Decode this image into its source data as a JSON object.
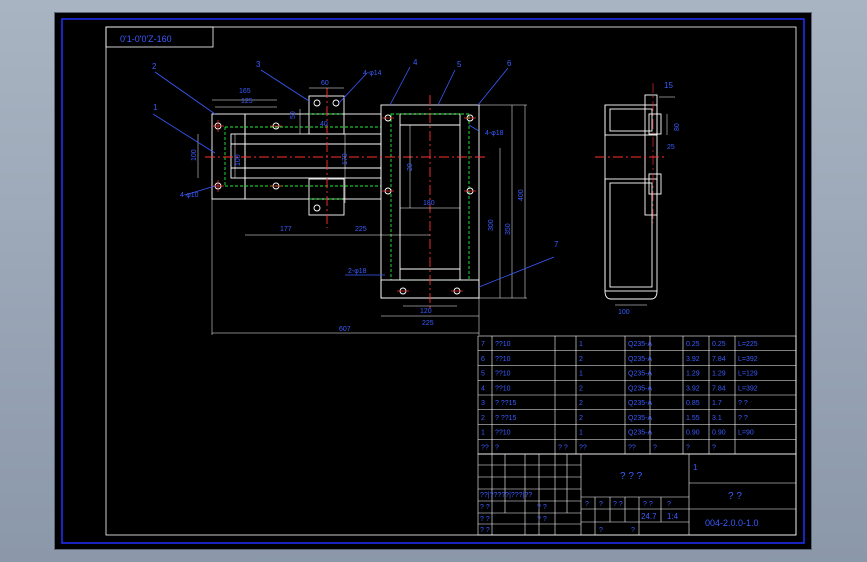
{
  "title_stamp": "0'1-0'0'Z-160",
  "balloons": [
    "1",
    "2",
    "3",
    "4",
    "5",
    "6",
    "7",
    "15"
  ],
  "dims": {
    "d165": "165",
    "d125": "125",
    "d60": "60",
    "d50": "50",
    "d40": "40",
    "d4phi14": "4-φ14",
    "d4phi10": "4-φ10",
    "d4phi18": "4-φ18",
    "d2phi18": "2-φ18",
    "d100a": "100",
    "d100b": "100",
    "d120": "120",
    "d170": "170",
    "d180": "180",
    "d177": "177",
    "d225a": "225",
    "d225b": "225",
    "d300": "300",
    "d350": "350",
    "d400": "400",
    "d607": "607",
    "d80": "80",
    "d25": "25",
    "d100c": "100",
    "d20": "20"
  },
  "bom": {
    "rows": [
      [
        "7",
        "??10",
        "1",
        "Q235-A",
        "0.25",
        "0.25",
        "L=225"
      ],
      [
        "6",
        "??10",
        "2",
        "Q235-A",
        "3.92",
        "7.84",
        "L=392"
      ],
      [
        "5",
        "??10",
        "1",
        "Q235-A",
        "1.29",
        "1.29",
        "L=129"
      ],
      [
        "4",
        "??10",
        "2",
        "Q235-A",
        "3.92",
        "7.84",
        "L=392"
      ],
      [
        "3",
        "? ??15",
        "2",
        "Q235-A",
        "0.85",
        "1.7",
        "?  ?"
      ],
      [
        "2",
        "? ??15",
        "2",
        "Q235-A",
        "1.55",
        "3.1",
        "?  ?"
      ],
      [
        "1",
        "??10",
        "1",
        "Q235-A",
        "0.90",
        "0.90",
        "L=90"
      ]
    ],
    "header": [
      "??",
      "?",
      "? ?",
      "??",
      "??",
      "?",
      "?",
      "?"
    ]
  },
  "title_block": {
    "center_text": "? ? ?",
    "right_text": "?  ?",
    "mark": "1",
    "drawing_no": "004-2.0.0-1.0",
    "left_rows": [
      "??|?????|???|??",
      "? ?",
      "? ?",
      "? ?"
    ],
    "scale_row": [
      "?",
      "?",
      "? ?",
      "? ?",
      "?"
    ],
    "weight": "24.7",
    "scale": "1:4",
    "sheet_a": "?",
    "sheet_b": "?"
  }
}
